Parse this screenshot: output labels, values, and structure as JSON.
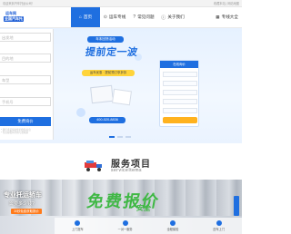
{
  "topbar": {
    "left_text": "欢迎来到汽车托运公司！",
    "right_text": "收藏本站 | 网站地图"
  },
  "logo": {
    "line1": "运车网",
    "line2": "全国汽车托运"
  },
  "nav": {
    "items": [
      {
        "label": "首页",
        "icon": "home-icon",
        "glyph": "⌂",
        "active": true
      },
      {
        "label": "运车专线",
        "icon": "route-icon",
        "glyph": "⊙",
        "active": false
      },
      {
        "label": "常见问题",
        "icon": "question-icon",
        "glyph": "?",
        "active": false
      },
      {
        "label": "关于我们",
        "icon": "info-icon",
        "glyph": "ⓘ",
        "active": false
      }
    ],
    "end_label": "专线大全",
    "end_icon": "grid-icon",
    "end_glyph": "▦"
  },
  "form": {
    "fields": [
      {
        "placeholder": "出发地"
      },
      {
        "placeholder": "目的地"
      },
      {
        "placeholder": "车型"
      },
      {
        "placeholder": "手机号"
      }
    ],
    "submit_label": "免费询价",
    "notes": [
      "* 我们承诺保护您的隐私信息",
      "* 专业客服将尽快与您联系"
    ]
  },
  "banner": {
    "tag": "年末回馈活动",
    "headline": "提前定一波",
    "ribbon": "运车优惠 · 提前预订享折扣",
    "phone": "400-020-8836"
  },
  "quote_card": {
    "title": "在线询价"
  },
  "carousel": {
    "count": 3,
    "active_index": 0
  },
  "section": {
    "title_cn": "服务项目",
    "title_en": "serviceItems"
  },
  "bottom": {
    "line1": "专业托运轿车",
    "line2": "需要多少钱?",
    "button": "30秒免费获取报价",
    "promo": "免费报价",
    "promo_sub": "安全",
    "steps": [
      "上门提车",
      "一对一服务",
      "全程保险",
      "送车上门"
    ]
  },
  "colors": {
    "primary": "#1f6fe0",
    "accent_green": "#3fb844",
    "accent_orange": "#ff7a1a",
    "accent_yellow": "#ffd43b"
  }
}
